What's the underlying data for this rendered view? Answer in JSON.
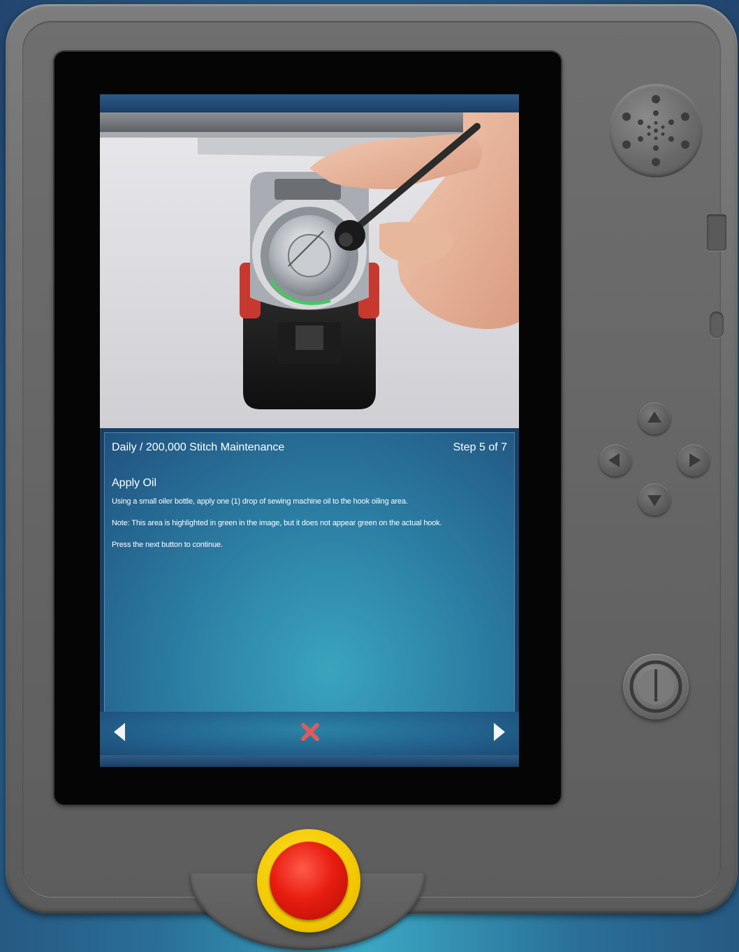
{
  "panel": {
    "title": "Daily / 200,000 Stitch Maintenance",
    "step": "Step 5 of 7",
    "heading": "Apply Oil",
    "instructions": [
      "Using a small oiler bottle, apply one (1) drop of sewing machine oil to the hook oiling area.",
      "Note: This area is highlighted in green in the image, but it does not appear green on the actual hook.",
      "Press the next button to continue."
    ]
  },
  "navigation": {
    "back_icon": "triangle-left-icon",
    "cancel_icon": "x-icon",
    "next_icon": "triangle-right-icon"
  },
  "colors": {
    "panel_bg": "#2c7fa4",
    "cancel_red": "#e05a5a",
    "estop_red": "#e81d10",
    "estop_yellow": "#f3c900",
    "oil_highlight": "#3ccf5a"
  }
}
